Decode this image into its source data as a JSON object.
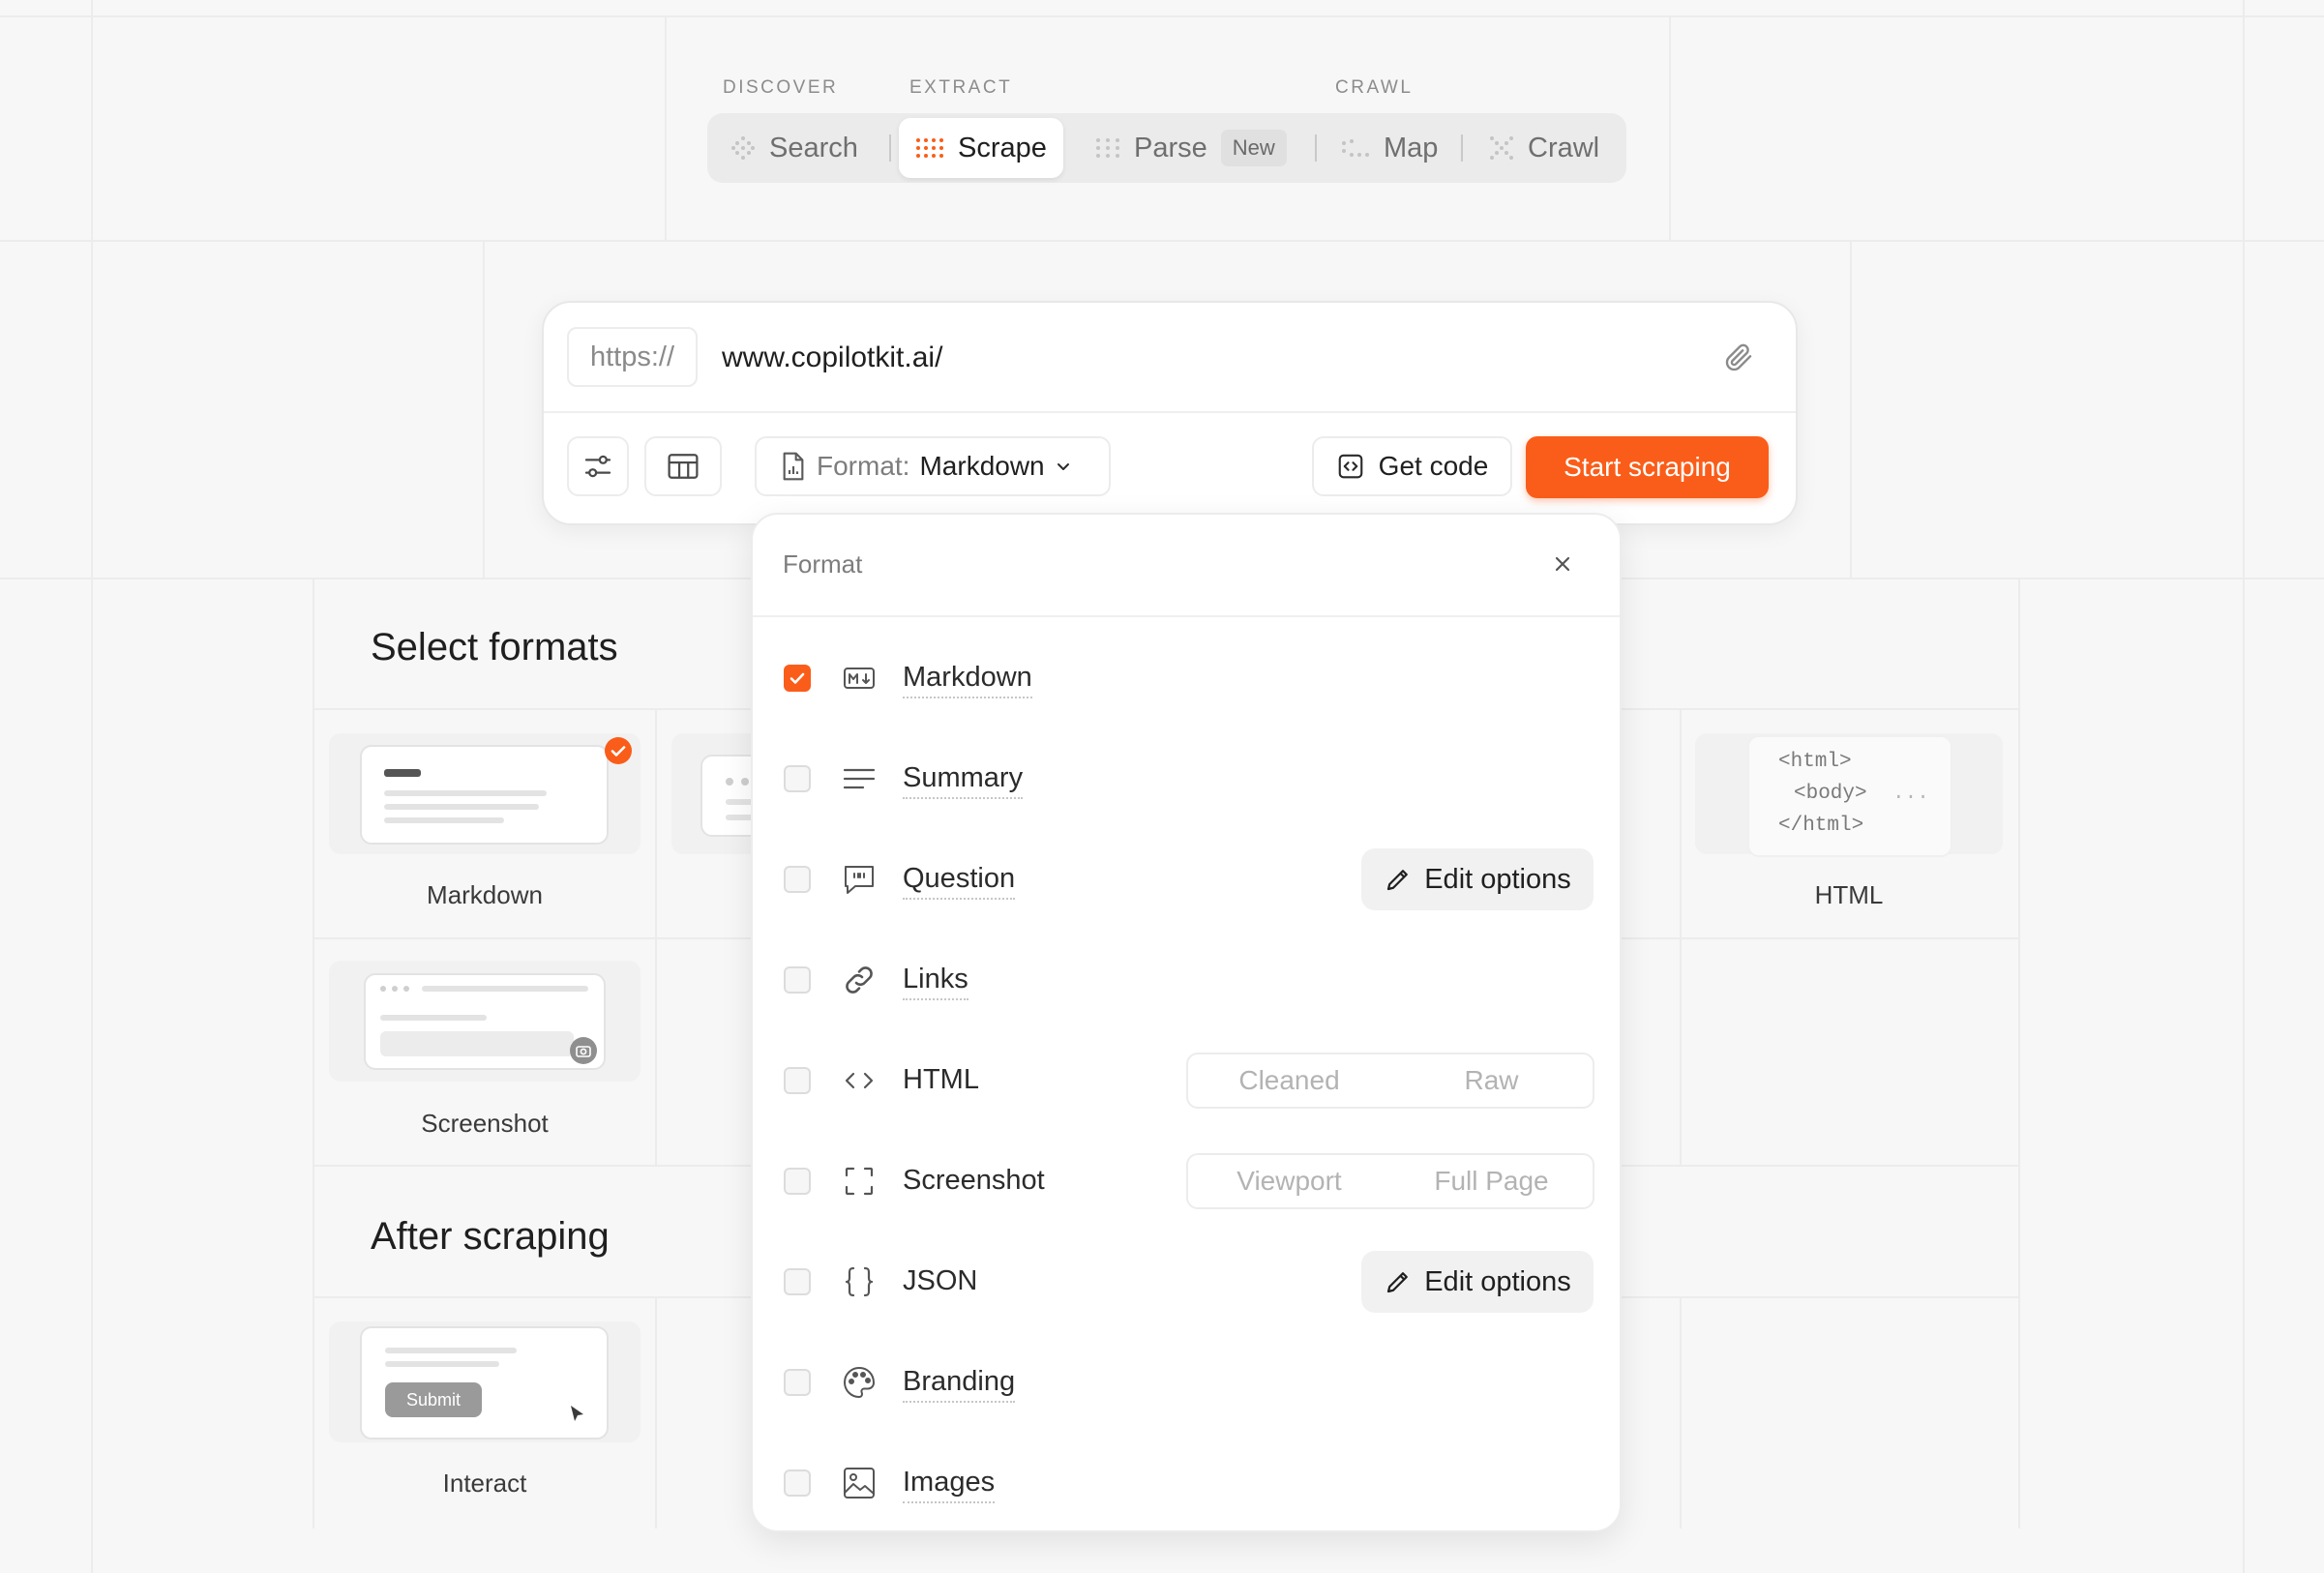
{
  "top_nav": {
    "groups": [
      "DISCOVER",
      "EXTRACT",
      "CRAWL"
    ],
    "tabs": [
      {
        "label": "Search",
        "icon": "search-dots-icon"
      },
      {
        "label": "Scrape",
        "icon": "scrape-dots-icon",
        "active": true
      },
      {
        "label": "Parse",
        "icon": "parse-dots-icon",
        "badge": "New"
      },
      {
        "label": "Map",
        "icon": "map-dots-icon"
      },
      {
        "label": "Crawl",
        "icon": "crawl-dots-icon"
      }
    ]
  },
  "url_bar": {
    "protocol": "https://",
    "url": "www.copilotkit.ai/",
    "format_label": "Format:",
    "format_value": "Markdown",
    "get_code": "Get code",
    "start": "Start scraping"
  },
  "background": {
    "select_formats_title": "Select formats",
    "after_scraping_title": "After scraping",
    "cards": {
      "markdown": "Markdown",
      "html": "HTML",
      "screenshot": "Screenshot",
      "interact": "Interact",
      "submit": "Submit"
    },
    "html_snippet": [
      "<html>",
      "<body>",
      "...",
      "</html>"
    ]
  },
  "format_panel": {
    "title": "Format",
    "items": [
      {
        "label": "Markdown",
        "checked": true,
        "icon": "markdown-icon"
      },
      {
        "label": "Summary",
        "checked": false,
        "icon": "summary-lines-icon"
      },
      {
        "label": "Question",
        "checked": false,
        "icon": "question-quote-icon",
        "action": "Edit options"
      },
      {
        "label": "Links",
        "checked": false,
        "icon": "link-icon"
      },
      {
        "label": "HTML",
        "checked": false,
        "icon": "code-brackets-icon",
        "options": [
          "Cleaned",
          "Raw"
        ]
      },
      {
        "label": "Screenshot",
        "checked": false,
        "icon": "screenshot-frame-icon",
        "options": [
          "Viewport",
          "Full Page"
        ]
      },
      {
        "label": "JSON",
        "checked": false,
        "icon": "json-braces-icon",
        "action": "Edit options"
      },
      {
        "label": "Branding",
        "checked": false,
        "icon": "palette-icon"
      },
      {
        "label": "Images",
        "checked": false,
        "icon": "image-icon"
      }
    ]
  },
  "colors": {
    "accent": "#fa5d19",
    "background": "#f7f7f7"
  }
}
